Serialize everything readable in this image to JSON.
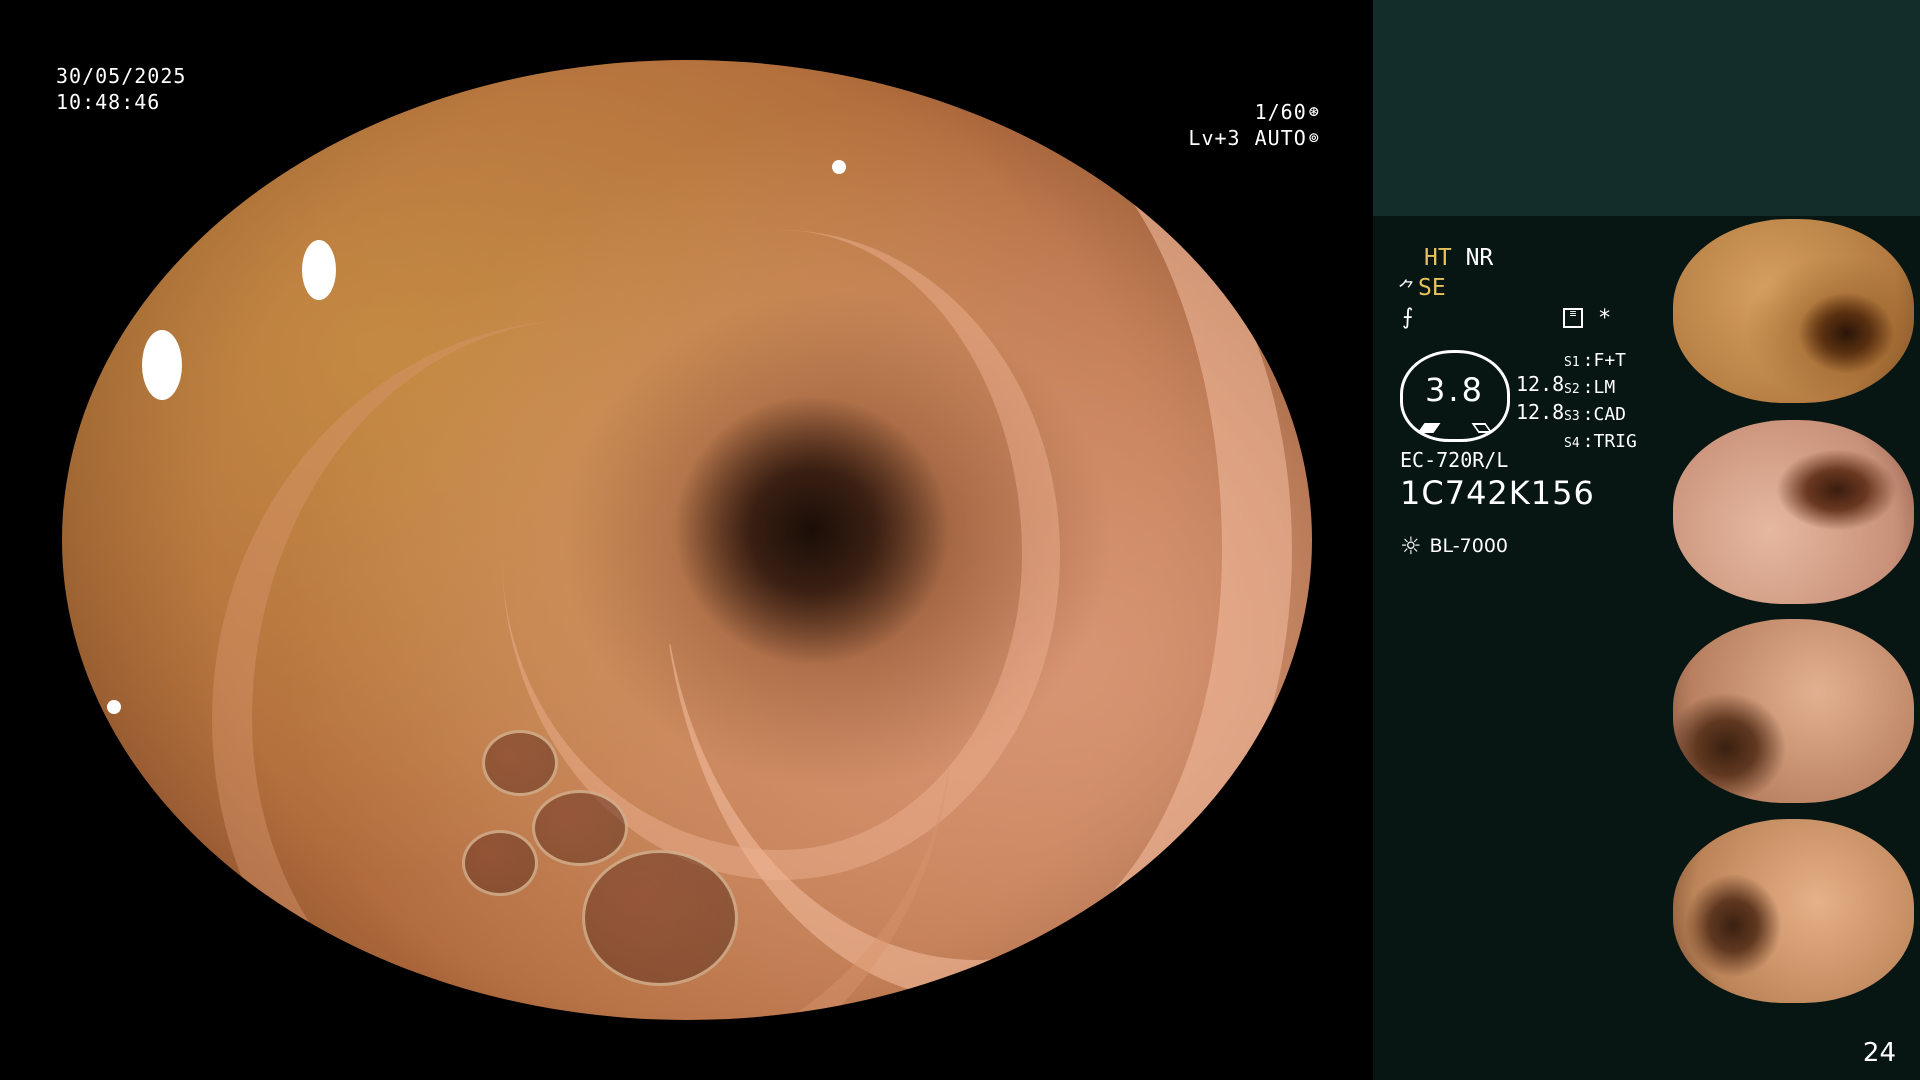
{
  "overlay": {
    "date": "30/05/2025",
    "time": "10:48:46",
    "shutter": "1/60",
    "level": "Lv+3",
    "exposure_mode": "AUTO"
  },
  "panel": {
    "mode_ht": "HT",
    "mode_nr": "NR",
    "mode_se": "SE",
    "gauge_value": "3.8",
    "gauge_num_1": "12.8",
    "gauge_num_2": "12.8",
    "settings": [
      {
        "key": "S1",
        "value": "F+T"
      },
      {
        "key": "S2",
        "value": "LM"
      },
      {
        "key": "S3",
        "value": "CAD"
      },
      {
        "key": "S4",
        "value": "TRIG"
      }
    ],
    "scope_model": "EC-720R/L",
    "scope_serial": "1C742K156",
    "light_source": "BL-7000",
    "asterisk": "*",
    "icons": {
      "structure": "structure-enhance-icon",
      "slash": "color-mode-icon",
      "stack": "image-stack-icon",
      "sun": "light-source-icon",
      "shutter": "shutter-icon",
      "auto": "auto-exposure-icon"
    },
    "accent_color": "#e8c25a",
    "panel_color": "#071513",
    "panel_top_color": "#112e2a"
  },
  "page_number": "24"
}
